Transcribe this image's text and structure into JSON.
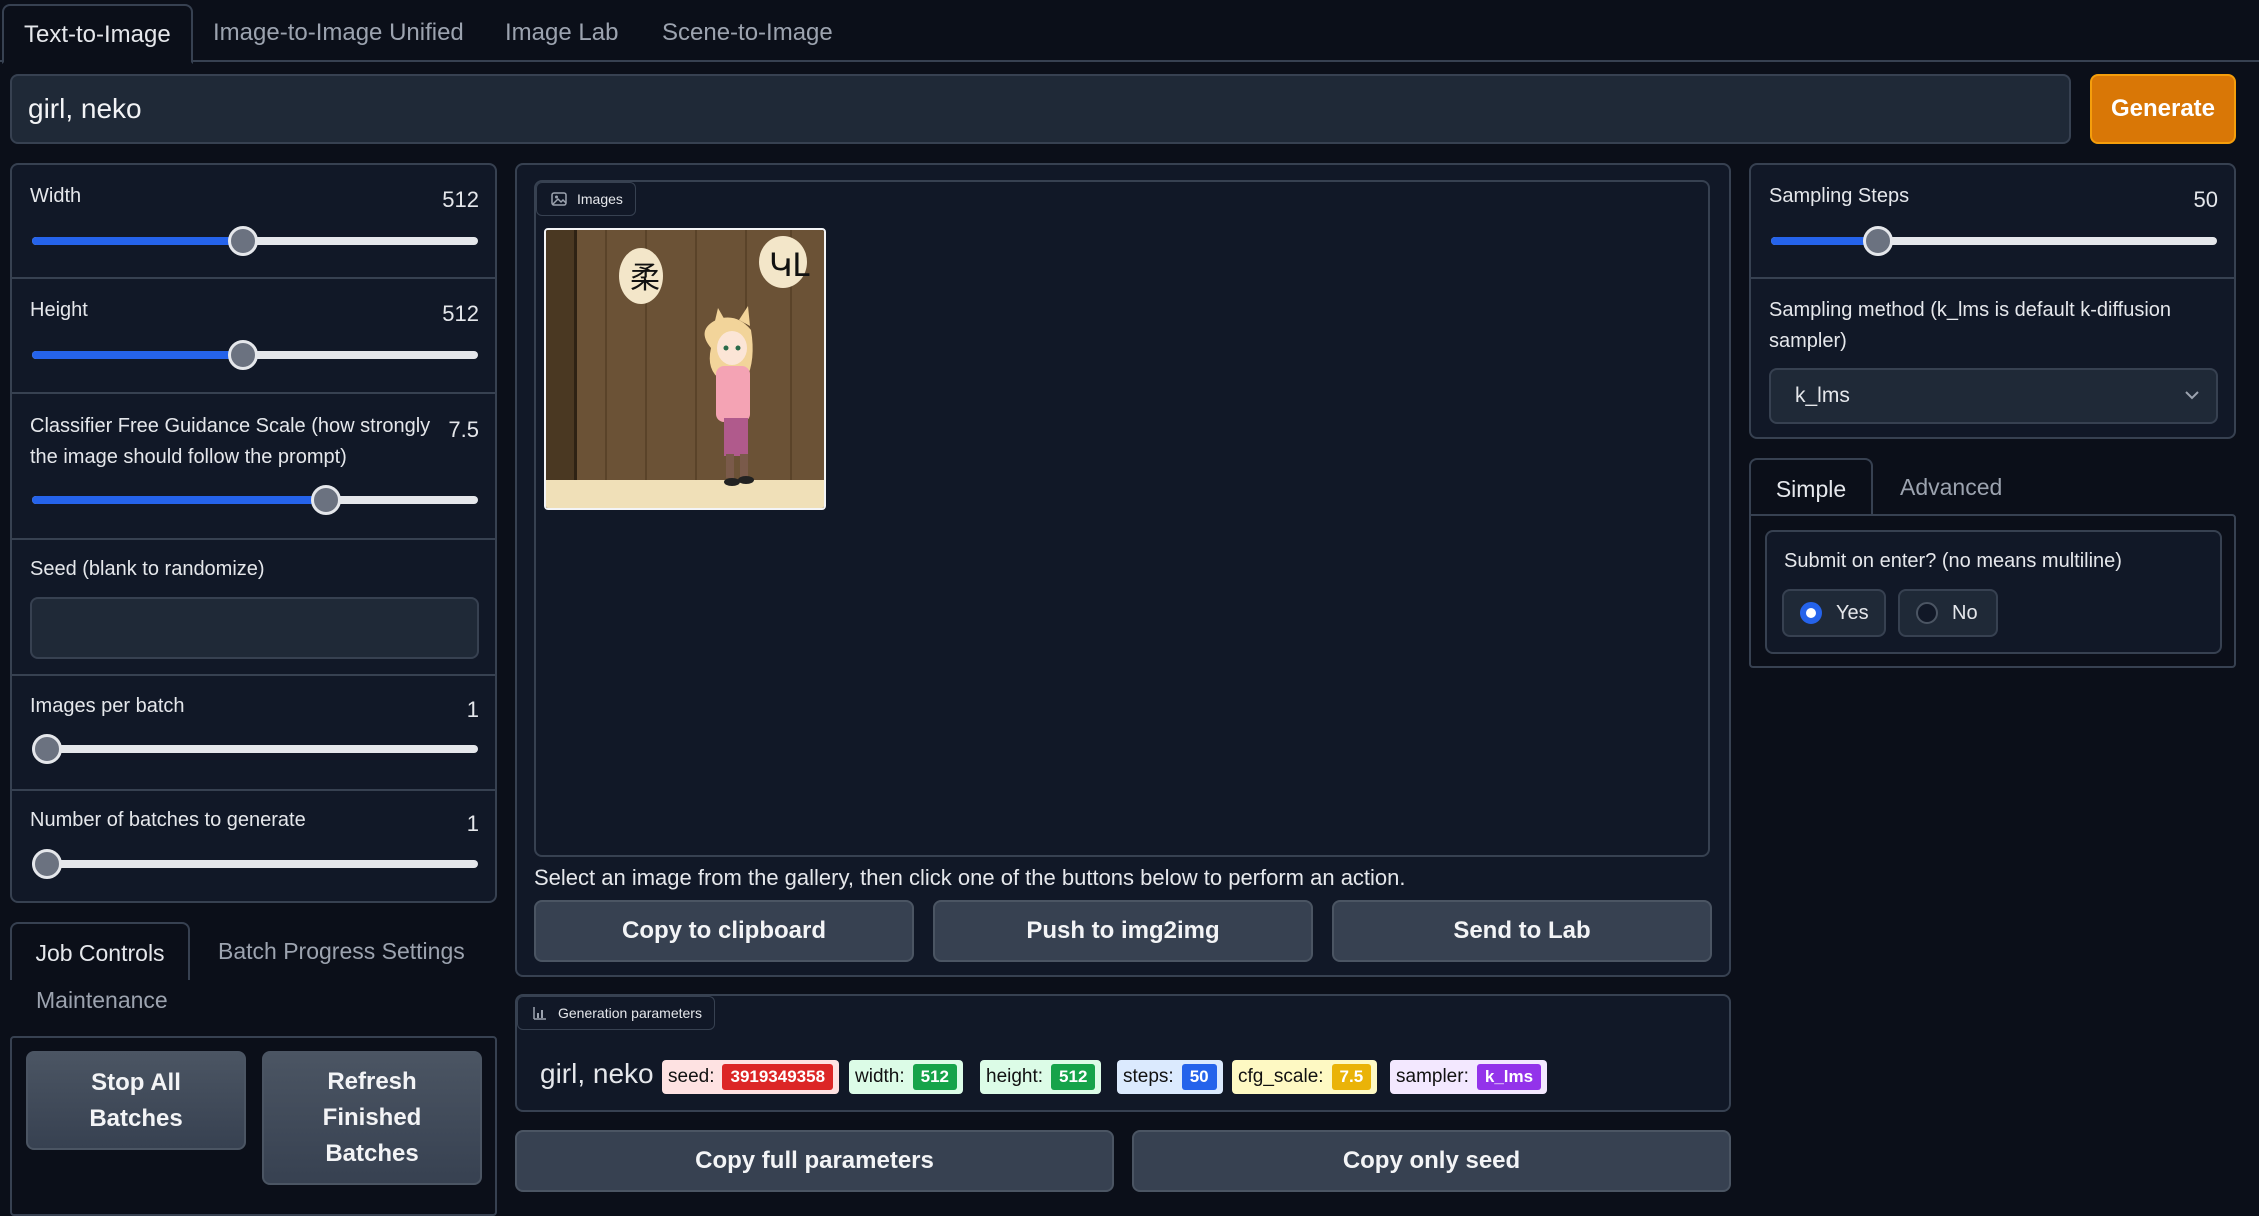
{
  "tabs": [
    "Text-to-Image",
    "Image-to-Image Unified",
    "Image Lab",
    "Scene-to-Image"
  ],
  "prompt": {
    "value": "girl, neko"
  },
  "generate_label": "Generate",
  "left": {
    "width": {
      "label": "Width",
      "value": "512",
      "level": 0.47
    },
    "height": {
      "label": "Height",
      "value": "512",
      "level": 0.47
    },
    "cfg": {
      "label": "Classifier Free Guidance Scale (how strongly the image should follow the prompt)",
      "value": "7.5",
      "level": 0.67
    },
    "seed": {
      "label": "Seed (blank to randomize)",
      "value": ""
    },
    "images_per_batch": {
      "label": "Images per batch",
      "value": "1",
      "level": 0.0
    },
    "num_batches": {
      "label": "Number of batches to generate",
      "value": "1",
      "level": 0.0
    }
  },
  "job_tabs": [
    "Job Controls",
    "Batch Progress Settings",
    "Maintenance"
  ],
  "job_buttons": {
    "stop_all": [
      "Stop All",
      "Batches"
    ],
    "refresh": [
      "Refresh",
      "Finished",
      "Batches"
    ]
  },
  "gallery": {
    "label": "Images",
    "hint": "Select an image from the gallery, then click one of the buttons below to perform an action.",
    "buttons": [
      "Copy to clipboard",
      "Push to img2img",
      "Send to Lab"
    ]
  },
  "gen_params": {
    "label": "Generation parameters",
    "prompt": "girl, neko",
    "items": [
      {
        "key": "seed:",
        "value": "3919349358",
        "bg": "#fee2e2",
        "accent": "#dc2626"
      },
      {
        "key": "width:",
        "value": "512",
        "bg": "#dcfce7",
        "accent": "#16a34a"
      },
      {
        "key": "height:",
        "value": "512",
        "bg": "#dcfce7",
        "accent": "#16a34a"
      },
      {
        "key": "steps:",
        "value": "50",
        "bg": "#dbeafe",
        "accent": "#2563eb"
      },
      {
        "key": "cfg_scale:",
        "value": "7.5",
        "bg": "#fef9c3",
        "accent": "#eab308"
      },
      {
        "key": "sampler:",
        "value": "k_lms",
        "bg": "#f3e8ff",
        "accent": "#9333ea"
      }
    ]
  },
  "copy_buttons": [
    "Copy full parameters",
    "Copy only seed"
  ],
  "right": {
    "steps": {
      "label": "Sampling Steps",
      "value": "50",
      "level": 0.22
    },
    "sampler": {
      "label": "Sampling method (k_lms is default k-diffusion sampler)",
      "value": "k_lms"
    },
    "tabs": [
      "Simple",
      "Advanced"
    ],
    "submit_label": "Submit on enter? (no means multiline)",
    "options": [
      "Yes",
      "No"
    ],
    "selected": "Yes"
  },
  "colors": {
    "accent": "#2563eb",
    "generate": "#d97706",
    "background": "#0b0f19"
  }
}
